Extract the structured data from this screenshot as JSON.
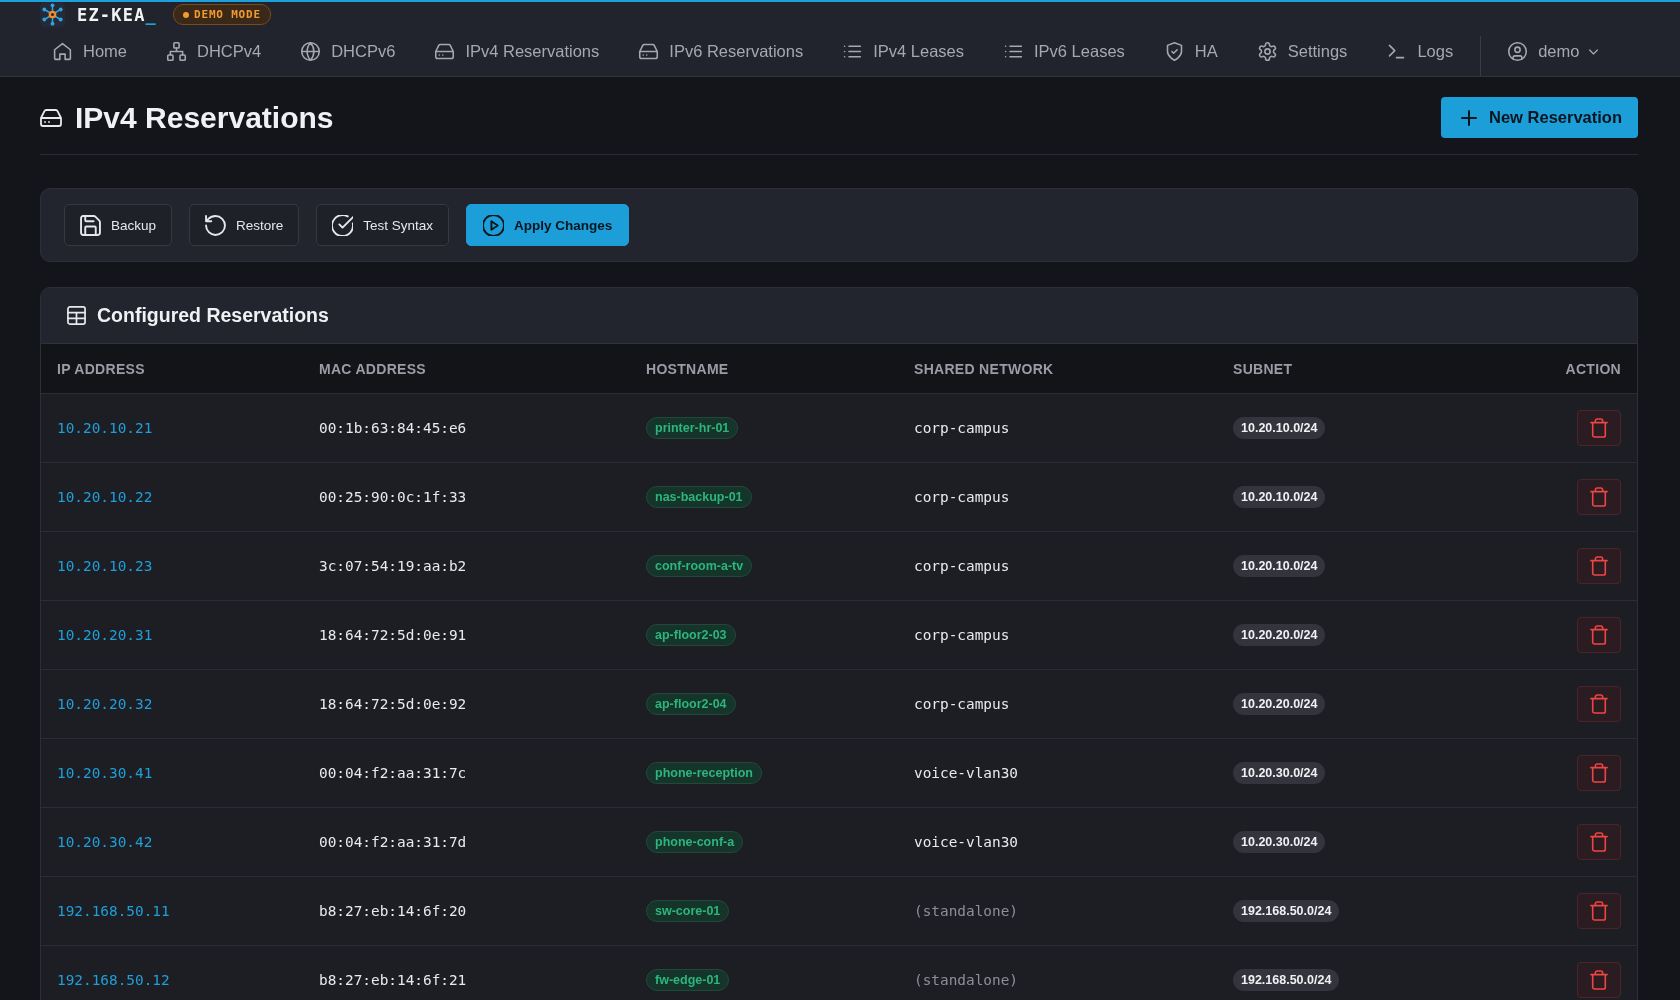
{
  "header": {
    "app_name": "EZ-KEA",
    "cursor": "_",
    "badge": "DEMO MODE",
    "nav": [
      {
        "label": "Home",
        "selected": false
      },
      {
        "label": "DHCPv4",
        "selected": false
      },
      {
        "label": "DHCPv6",
        "selected": false
      },
      {
        "label": "IPv4 Reservations",
        "selected": false
      },
      {
        "label": "IPv6 Reservations",
        "selected": false
      },
      {
        "label": "IPv4 Leases",
        "selected": false
      },
      {
        "label": "IPv6 Leases",
        "selected": false
      },
      {
        "label": "HA",
        "selected": false
      },
      {
        "label": "Settings",
        "selected": false
      },
      {
        "label": "Logs",
        "selected": false
      }
    ],
    "user": {
      "label": "demo"
    }
  },
  "page": {
    "title": "IPv4 Reservations",
    "new_button": "New Reservation"
  },
  "toolbar": [
    {
      "label": "Backup",
      "kind": "secondary"
    },
    {
      "label": "Restore",
      "kind": "secondary"
    },
    {
      "label": "Test Syntax",
      "kind": "secondary"
    },
    {
      "label": "Apply Changes",
      "kind": "primary"
    }
  ],
  "table": {
    "title": "Configured Reservations",
    "columns": [
      "IP ADDRESS",
      "MAC ADDRESS",
      "HOSTNAME",
      "SHARED NETWORK",
      "SUBNET",
      "ACTION"
    ],
    "rows": [
      {
        "ip": "10.20.10.21",
        "mac": "00:1b:63:84:45:e6",
        "hostname": "printer-hr-01",
        "shared_network": "corp-campus",
        "standalone": false,
        "subnet": "10.20.10.0/24"
      },
      {
        "ip": "10.20.10.22",
        "mac": "00:25:90:0c:1f:33",
        "hostname": "nas-backup-01",
        "shared_network": "corp-campus",
        "standalone": false,
        "subnet": "10.20.10.0/24"
      },
      {
        "ip": "10.20.10.23",
        "mac": "3c:07:54:19:aa:b2",
        "hostname": "conf-room-a-tv",
        "shared_network": "corp-campus",
        "standalone": false,
        "subnet": "10.20.10.0/24"
      },
      {
        "ip": "10.20.20.31",
        "mac": "18:64:72:5d:0e:91",
        "hostname": "ap-floor2-03",
        "shared_network": "corp-campus",
        "standalone": false,
        "subnet": "10.20.20.0/24"
      },
      {
        "ip": "10.20.20.32",
        "mac": "18:64:72:5d:0e:92",
        "hostname": "ap-floor2-04",
        "shared_network": "corp-campus",
        "standalone": false,
        "subnet": "10.20.20.0/24"
      },
      {
        "ip": "10.20.30.41",
        "mac": "00:04:f2:aa:31:7c",
        "hostname": "phone-reception",
        "shared_network": "voice-vlan30",
        "standalone": false,
        "subnet": "10.20.30.0/24"
      },
      {
        "ip": "10.20.30.42",
        "mac": "00:04:f2:aa:31:7d",
        "hostname": "phone-conf-a",
        "shared_network": "voice-vlan30",
        "standalone": false,
        "subnet": "10.20.30.0/24"
      },
      {
        "ip": "192.168.50.11",
        "mac": "b8:27:eb:14:6f:20",
        "hostname": "sw-core-01",
        "shared_network": "(standalone)",
        "standalone": true,
        "subnet": "192.168.50.0/24"
      },
      {
        "ip": "192.168.50.12",
        "mac": "b8:27:eb:14:6f:21",
        "hostname": "fw-edge-01",
        "shared_network": "(standalone)",
        "standalone": true,
        "subnet": "192.168.50.0/24"
      }
    ]
  }
}
